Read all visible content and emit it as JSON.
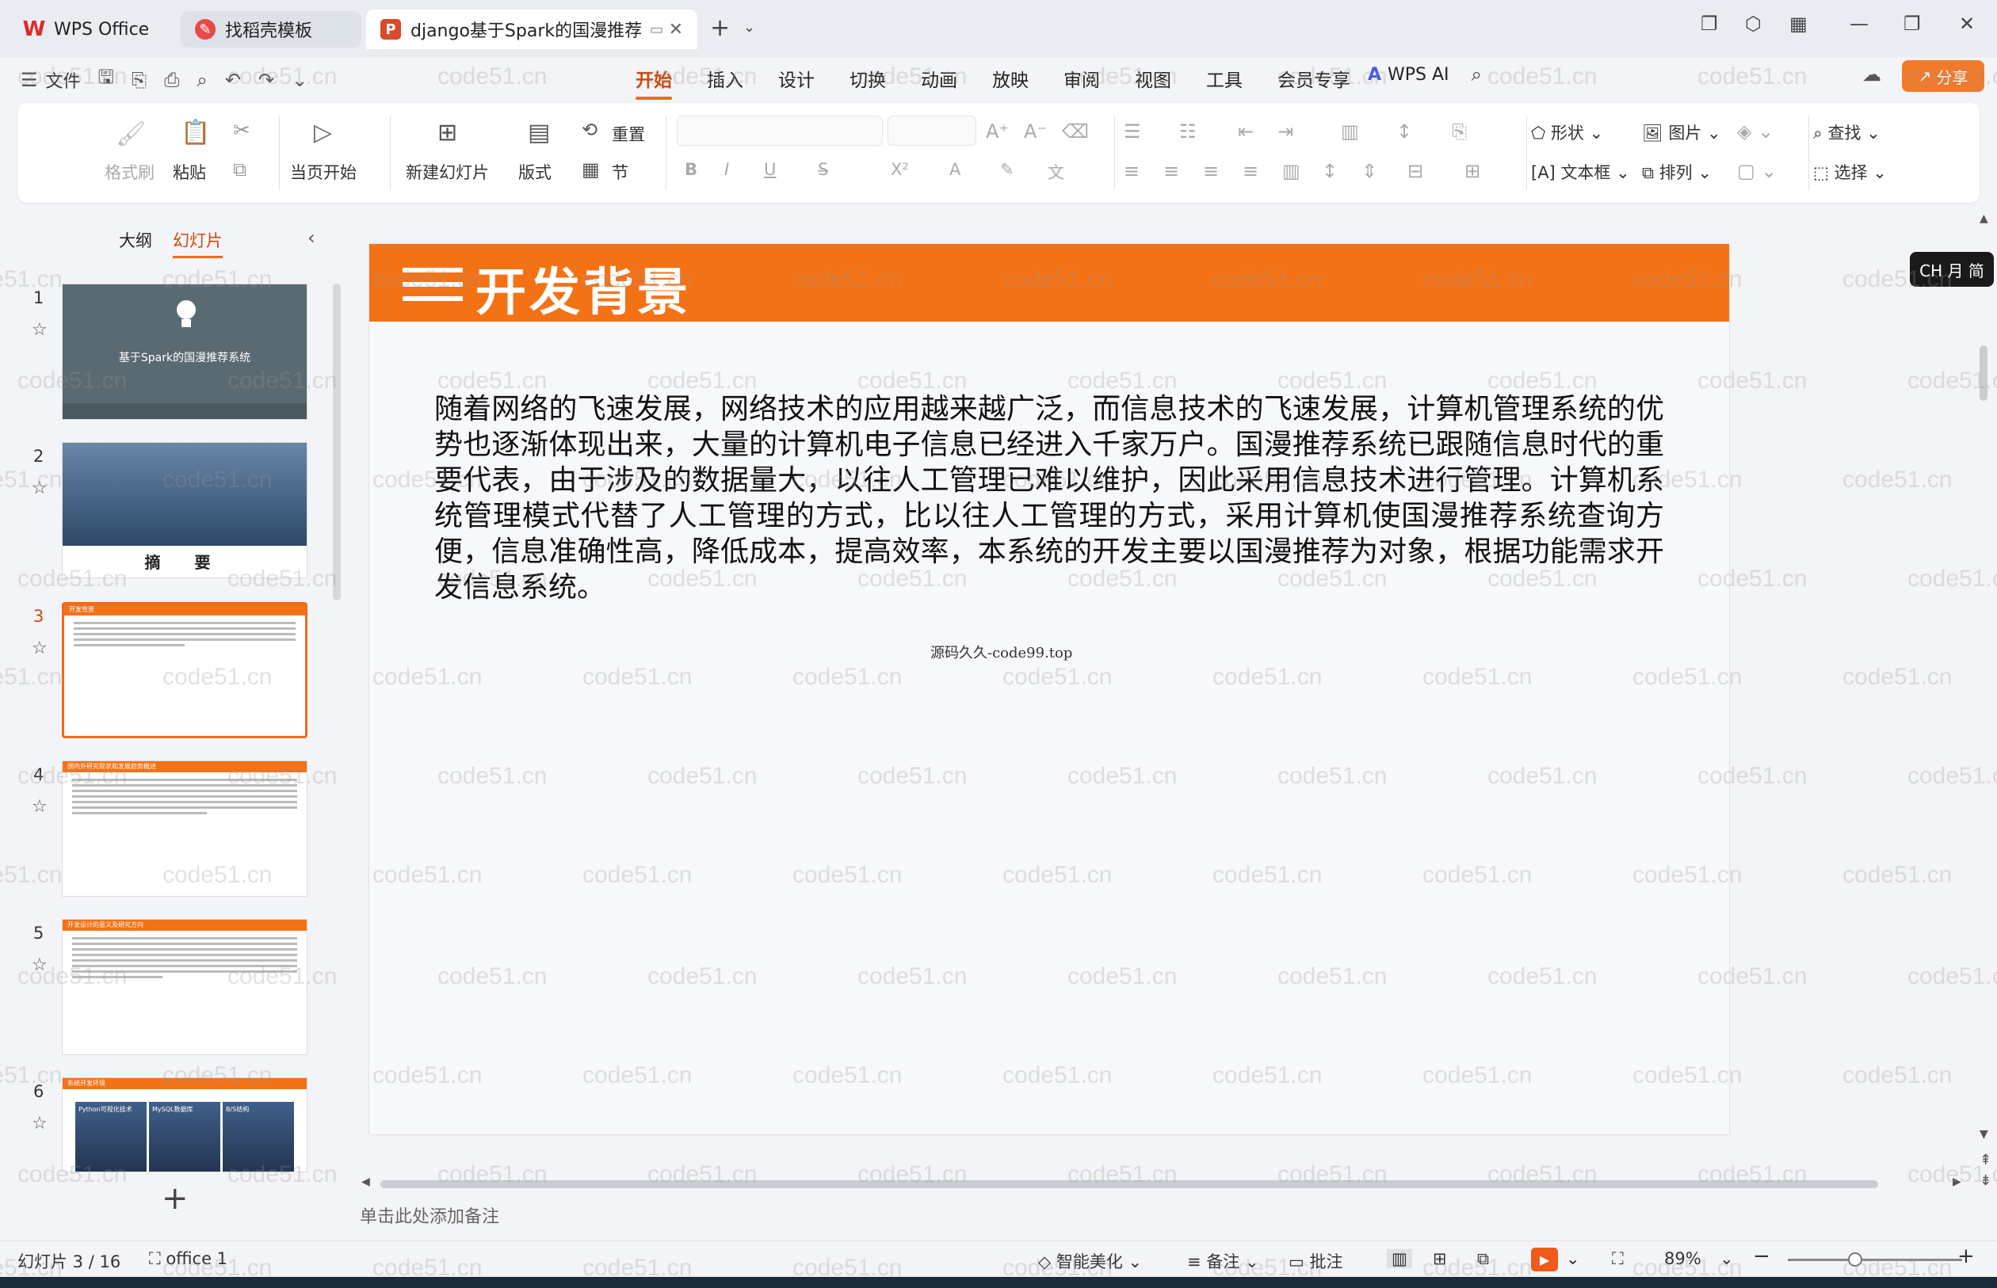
{
  "tabs": [
    {
      "label": "WPS Office",
      "icon": "wps-logo"
    },
    {
      "label": "找稻壳模板",
      "icon": "docer-icon"
    },
    {
      "label": "django基于Spark的国漫推荐",
      "icon": "ppt-icon"
    }
  ],
  "menu": {
    "file": "文件",
    "tabs": [
      "开始",
      "插入",
      "设计",
      "切换",
      "动画",
      "放映",
      "审阅",
      "视图",
      "工具",
      "会员专享"
    ],
    "active_tab": "开始",
    "wps_ai": "WPS AI",
    "share": "分享"
  },
  "ribbon": {
    "format_painter": "格式刷",
    "paste": "粘贴",
    "play_current": "当页开始",
    "new_slide": "新建幻灯片",
    "layout": "版式",
    "reset": "重置",
    "section": "节",
    "shape": "形状",
    "picture": "图片",
    "textbox": "文本框",
    "arrange": "排列",
    "find": "查找",
    "select": "选择"
  },
  "panel": {
    "outline_tab": "大纲",
    "slides_tab": "幻灯片",
    "thumbs": [
      {
        "num": "1",
        "title": "基于Spark的国漫推荐系统"
      },
      {
        "num": "2",
        "title": "摘 要"
      },
      {
        "num": "3",
        "title": "开发背景"
      },
      {
        "num": "4",
        "title": "国内外研究现状和发展趋势概述"
      },
      {
        "num": "5",
        "title": "开发设计的意义及研究方向"
      },
      {
        "num": "6",
        "title": "系统开发环境",
        "pics": [
          "Python可视化技术",
          "MySQL数据库",
          "B/S结构"
        ]
      }
    ]
  },
  "slide": {
    "title": "开发背景",
    "body": "随着网络的飞速发展，网络技术的应用越来越广泛，而信息技术的飞速发展，计算机管理系统的优势也逐渐体现出来，大量的计算机电子信息已经进入千家万户。国漫推荐系统已跟随信息时代的重要代表，由于涉及的数据量大，以往人工管理已难以维护，因此采用信息技术进行管理。计算机系统管理模式代替了人工管理的方式，比以往人工管理的方式，采用计算机使国漫推荐系统查询方便，信息准确性高，降低成本，提高效率，本系统的开发主要以国漫推荐为对象，根据功能需求开发信息系统。",
    "footer": "源码久久-code99.top",
    "accent_color": "#f47216"
  },
  "ime_badge": "CH ⽉ 简",
  "notes_placeholder": "单击此处添加备注",
  "status": {
    "slide_counter": "幻灯片 3 / 16",
    "theme": "office 1",
    "beautify": "智能美化",
    "notes": "备注",
    "comments": "批注",
    "zoom": "89%"
  },
  "watermark": "code51.cn"
}
